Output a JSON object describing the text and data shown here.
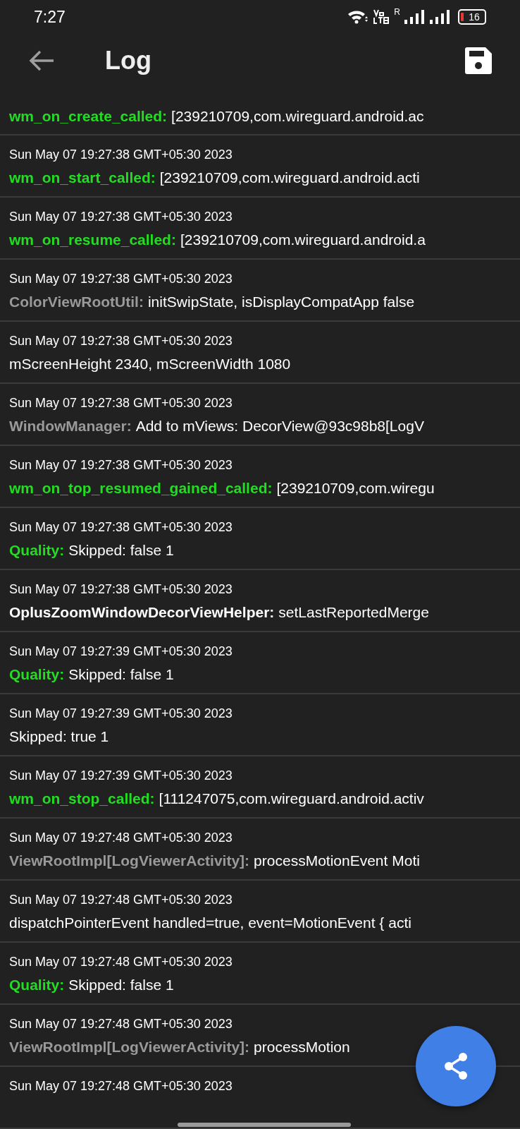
{
  "status_bar": {
    "time": "7:27",
    "roaming": "R",
    "battery": "16"
  },
  "app_bar": {
    "title": "Log"
  },
  "entries": [
    {
      "tag": "wm_on_create_called:",
      "color": "#22dd22",
      "message": "[239210709,com.wireguard.android.ac"
    },
    {
      "time": "Sun May 07 19:27:38 GMT+05:30 2023",
      "tag": "wm_on_start_called:",
      "color": "#22dd22",
      "message": "[239210709,com.wireguard.android.acti"
    },
    {
      "time": "Sun May 07 19:27:38 GMT+05:30 2023",
      "tag": "wm_on_resume_called:",
      "color": "#22dd22",
      "message": "[239210709,com.wireguard.android.a"
    },
    {
      "time": "Sun May 07 19:27:38 GMT+05:30 2023",
      "tag": "ColorViewRootUtil:",
      "color": "#9a9a9a",
      "message": "initSwipState, isDisplayCompatApp false"
    },
    {
      "time": "Sun May 07 19:27:38 GMT+05:30 2023",
      "message": "mScreenHeight 2340, mScreenWidth 1080"
    },
    {
      "time": "Sun May 07 19:27:38 GMT+05:30 2023",
      "tag": "WindowManager:",
      "color": "#9a9a9a",
      "message": "Add to mViews: DecorView@93c98b8[LogV"
    },
    {
      "time": "Sun May 07 19:27:38 GMT+05:30 2023",
      "tag": "wm_on_top_resumed_gained_called:",
      "color": "#22dd22",
      "message": "[239210709,com.wiregu"
    },
    {
      "time": "Sun May 07 19:27:38 GMT+05:30 2023",
      "tag": "Quality:",
      "color": "#22dd22",
      "message": "Skipped: false 1"
    },
    {
      "time": "Sun May 07 19:27:38 GMT+05:30 2023",
      "tag": "OplusZoomWindowDecorViewHelper:",
      "color": "#ffffff",
      "message": "setLastReportedMerge"
    },
    {
      "time": "Sun May 07 19:27:39 GMT+05:30 2023",
      "tag": "Quality:",
      "color": "#22dd22",
      "message": "Skipped: false 1"
    },
    {
      "time": "Sun May 07 19:27:39 GMT+05:30 2023",
      "message": "Skipped: true 1"
    },
    {
      "time": "Sun May 07 19:27:39 GMT+05:30 2023",
      "tag": "wm_on_stop_called:",
      "color": "#22dd22",
      "message": "[111247075,com.wireguard.android.activ"
    },
    {
      "time": "Sun May 07 19:27:48 GMT+05:30 2023",
      "tag": "ViewRootImpl[LogViewerActivity]:",
      "color": "#9a9a9a",
      "message": "processMotionEvent Moti"
    },
    {
      "time": "Sun May 07 19:27:48 GMT+05:30 2023",
      "message": "dispatchPointerEvent handled=true, event=MotionEvent { acti"
    },
    {
      "time": "Sun May 07 19:27:48 GMT+05:30 2023",
      "tag": "Quality:",
      "color": "#22dd22",
      "message": "Skipped: false 1"
    },
    {
      "time": "Sun May 07 19:27:48 GMT+05:30 2023",
      "tag": "ViewRootImpl[LogViewerActivity]:",
      "color": "#9a9a9a",
      "message": "processMotion"
    },
    {
      "time": "Sun May 07 19:27:48 GMT+05:30 2023"
    }
  ]
}
